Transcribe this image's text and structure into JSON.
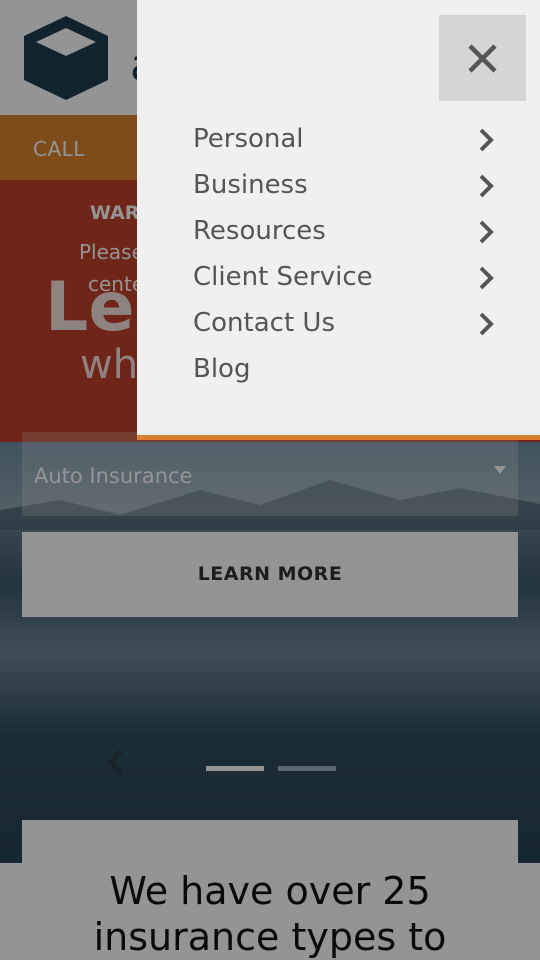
{
  "header": {
    "logo_letter": "a"
  },
  "callbar": {
    "label": "CALL"
  },
  "warning": {
    "title": "WAR",
    "text_line_1": "Please",
    "text_line_2": "cente"
  },
  "hero": {
    "headline": "Le",
    "subline": "wh"
  },
  "quote_form": {
    "select_value": "Auto Insurance",
    "learn_more_label": "LEARN MORE"
  },
  "carousel": {
    "slide_count": 2,
    "active_slide": 1
  },
  "bottom": {
    "line_1": "We have over 25",
    "line_2": "insurance types to"
  },
  "nav_menu": {
    "items": [
      {
        "label": "Personal",
        "has_submenu": true
      },
      {
        "label": "Business",
        "has_submenu": true
      },
      {
        "label": "Resources",
        "has_submenu": true
      },
      {
        "label": "Client Service",
        "has_submenu": true
      },
      {
        "label": "Contact Us",
        "has_submenu": true
      },
      {
        "label": "Blog",
        "has_submenu": false
      }
    ]
  },
  "icons": {
    "close": "close-icon",
    "chevron": "chevron-right-icon",
    "logo": "cube-logo-icon",
    "prev": "chevron-left-icon"
  },
  "colors": {
    "accent_orange": "#d9812e",
    "warning_red": "#c0402a",
    "brand_navy": "#1e3d52",
    "drawer_bg": "#f0f0f0"
  }
}
